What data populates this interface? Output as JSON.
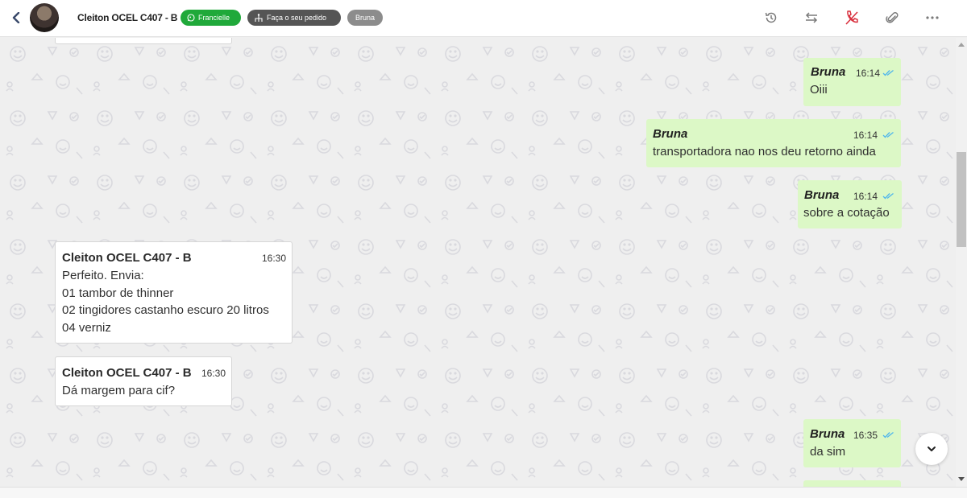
{
  "header": {
    "contact_name": "Cleiton OCEL C407 - B",
    "badge_agent": "Francielle",
    "badge_order": "Faça o seu pedido",
    "badge_user": "Bruna",
    "icons": [
      "back-arrow-icon",
      "history-icon",
      "transfer-icon",
      "end-call-icon",
      "attachment-icon",
      "more-icon"
    ]
  },
  "colors": {
    "outgoing_bubble": "#dcf8c6",
    "incoming_bubble": "#ffffff",
    "badge_green": "#20a93a",
    "badge_dark": "#555555",
    "badge_gray": "#8c8c8c",
    "ticks": "#4fb6ec",
    "end_call_red": "#d9303e"
  },
  "messages": [
    {
      "direction": "out",
      "sender": "Bruna",
      "time": "16:14",
      "lines": [
        "Oiii"
      ]
    },
    {
      "direction": "out",
      "sender": "Bruna",
      "time": "16:14",
      "lines": [
        "transportadora nao nos deu retorno ainda"
      ]
    },
    {
      "direction": "out",
      "sender": "Bruna",
      "time": "16:14",
      "lines": [
        "sobre a cotação"
      ]
    },
    {
      "direction": "in",
      "sender": "Cleiton OCEL C407 - B",
      "time": "16:30",
      "lines": [
        "Perfeito. Envia:",
        "01 tambor de thinner",
        "02 tingidores castanho escuro 20 litros",
        "04 verniz"
      ]
    },
    {
      "direction": "in",
      "sender": "Cleiton OCEL C407 - B",
      "time": "16:30",
      "lines": [
        "Dá margem para cif?"
      ]
    },
    {
      "direction": "out",
      "sender": "Bruna",
      "time": "16:35",
      "lines": [
        "da sim"
      ]
    }
  ]
}
